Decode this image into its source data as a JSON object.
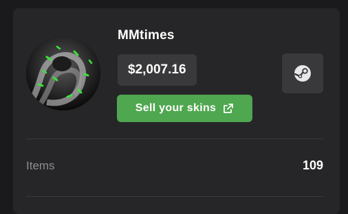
{
  "profile": {
    "username": "MMtimes",
    "balance": "$2,007.16",
    "avatar_icon": "snake-avatar-icon"
  },
  "actions": {
    "sell_label": "Sell your skins",
    "sell_icon": "external-link-icon",
    "steam_icon": "steam-icon"
  },
  "stats": [
    {
      "label": "Items",
      "value": "109"
    }
  ],
  "colors": {
    "accent_green": "#4fa74f",
    "card_bg": "#262628",
    "pill_bg": "#39393b",
    "page_bg": "#1a1a1c"
  }
}
